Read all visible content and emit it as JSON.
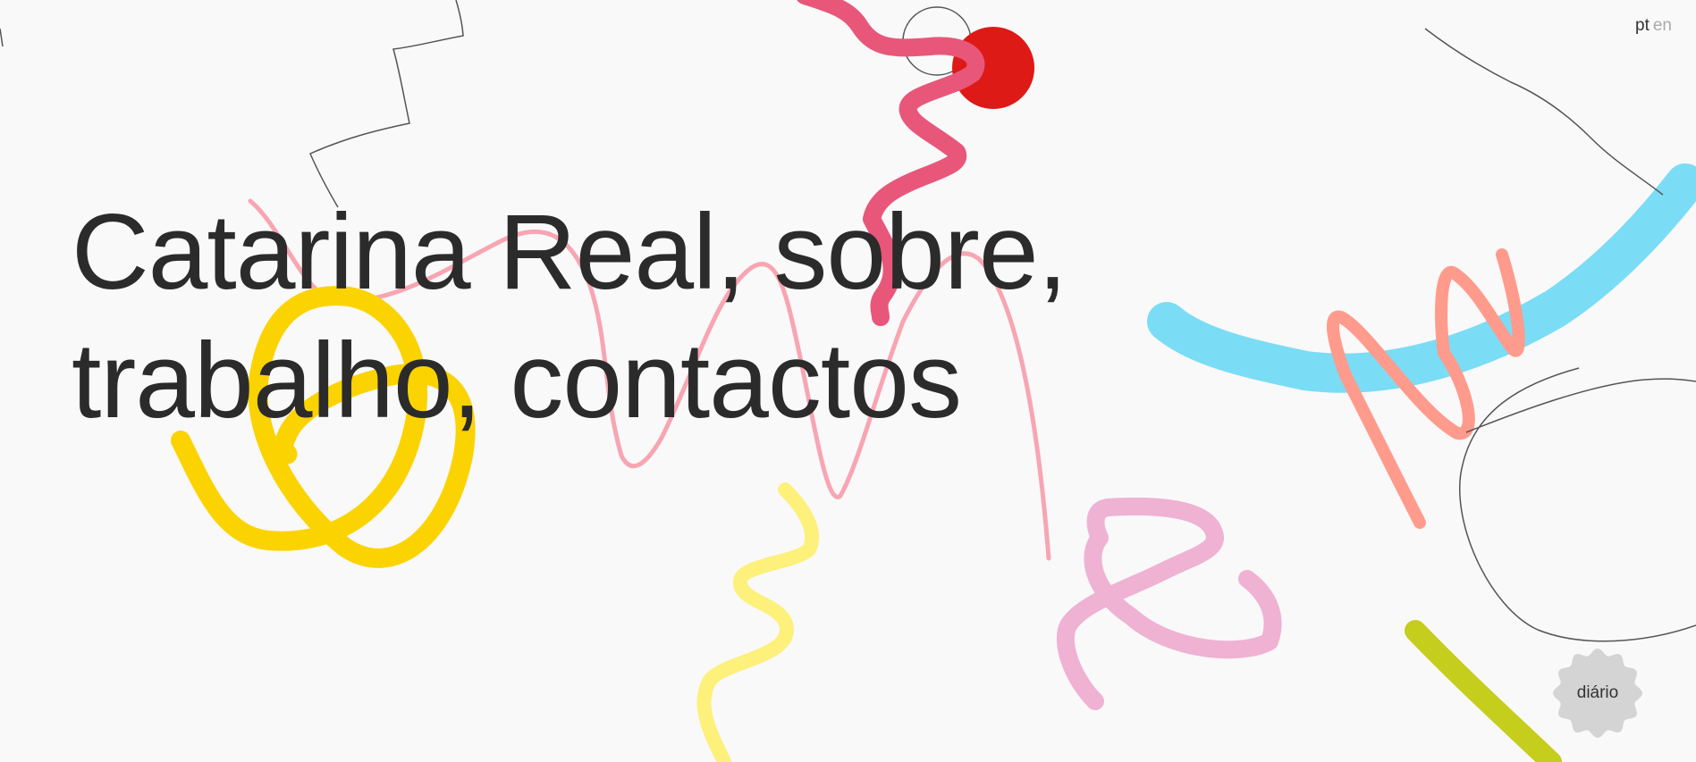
{
  "language_switch": {
    "pt": "pt",
    "en": "en"
  },
  "headline": {
    "name": "Catarina Real",
    "comma_1": ", ",
    "about": "sobre",
    "comma_2": ",",
    "work": "trabalho",
    "comma_3": ", ",
    "contacts": "contactos"
  },
  "diary_badge": {
    "label": "diário",
    "color": "#d4d4d4"
  },
  "doodle_colors": {
    "thin_line": "#555555",
    "red_pink": "#e8577a",
    "red_dot": "#dd1a16",
    "light_pink": "#f8a5b2",
    "yellow": "#fbd300",
    "pale_yellow": "#fdf07b",
    "cyan": "#7bdcf5",
    "salmon": "#ff9b8c",
    "lilac_pink": "#efb2d3",
    "lime": "#c5ce1c"
  }
}
